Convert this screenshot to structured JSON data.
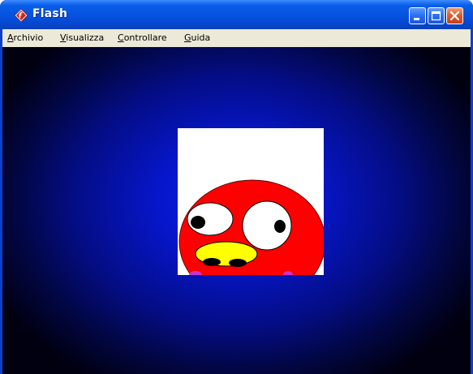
{
  "window": {
    "title": "Flash",
    "icon": "flash-player-icon",
    "controls": [
      "minimize-icon",
      "maximize-icon",
      "close-icon"
    ]
  },
  "menubar": {
    "items": [
      {
        "label": "Archivio",
        "mnemonic": "A",
        "rest": "rchivio"
      },
      {
        "label": "Visualizza",
        "mnemonic": "V",
        "rest": "isualizza"
      },
      {
        "label": "Controllare",
        "mnemonic": "C",
        "rest": "ontrollare"
      },
      {
        "label": "Guida",
        "mnemonic": "G",
        "rest": "uida"
      }
    ]
  },
  "content": {
    "background_center_color": "#0a1ff0",
    "background_edge_color": "#000010",
    "stage_background": "#ffffff",
    "character": {
      "face_color": "#ff0000",
      "beak_color": "#ffff00",
      "eye_color": "#ffffff",
      "pupil_color": "#000000",
      "accent_color": "#cc33cc"
    }
  }
}
